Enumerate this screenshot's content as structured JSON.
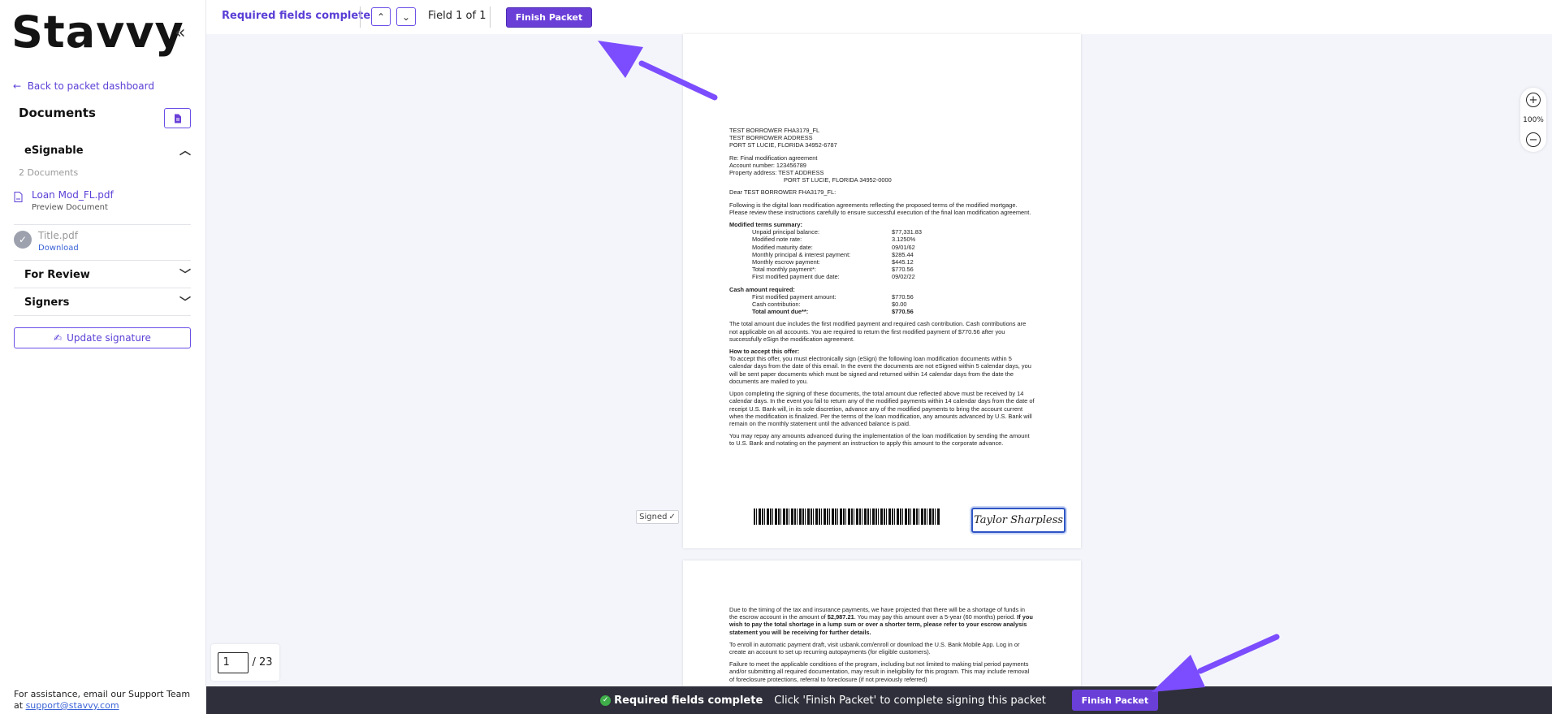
{
  "sidebar": {
    "logo": "Stavvy",
    "collapse_icon": "«",
    "back_link": "Back to packet dashboard",
    "documents_title": "Documents",
    "esignable": {
      "title": "eSignable",
      "count": "2 Documents",
      "docs": [
        {
          "name": "Loan Mod_FL.pdf",
          "sub": "Preview Document"
        },
        {
          "name": "Title.pdf",
          "sub": "Download"
        }
      ]
    },
    "for_review": "For Review",
    "signers": "Signers",
    "update_signature": "Update signature",
    "help_text": "For assistance, email our Support Team at",
    "help_email": "support@stavvy.com"
  },
  "toolbar": {
    "required_status": "Required fields complete",
    "field_count": "Field 1 of 1",
    "finish_label": "Finish Packet"
  },
  "document": {
    "address_lines": [
      "TEST BORROWER FHA3179_FL",
      "TEST BORROWER ADDRESS",
      "PORT ST LUCIE, FLORIDA 34952-6787"
    ],
    "re_lines": [
      "Re: Final modification agreement",
      "Account number: 123456789",
      "Property address: TEST ADDRESS"
    ],
    "re_city": "PORT ST LUCIE, FLORIDA 34952-0000",
    "greeting": "Dear TEST BORROWER FHA3179_FL:",
    "intro": "Following is the digital loan modification agreements reflecting the proposed terms of the modified mortgage. Please review these instructions carefully to ensure successful execution of the final loan modification agreement.",
    "terms_title": "Modified terms summary:",
    "terms": [
      {
        "k": "Unpaid principal balance:",
        "v": "$77,331.83"
      },
      {
        "k": "Modified note rate:",
        "v": "3.1250%"
      },
      {
        "k": "Modified maturity date:",
        "v": "09/01/62"
      },
      {
        "k": "Monthly principal & interest payment:",
        "v": "$285.44"
      },
      {
        "k": "Monthly escrow payment:",
        "v": "$445.12"
      },
      {
        "k": "Total monthly payment*:",
        "v": "$770.56"
      },
      {
        "k": "First modified payment due date:",
        "v": "09/02/22"
      }
    ],
    "cash_title": "Cash amount required:",
    "cash": [
      {
        "k": "First modified payment amount:",
        "v": "$770.56"
      },
      {
        "k": "Cash contribution:",
        "v": "$0.00"
      }
    ],
    "cash_total": {
      "k": "Total amount due**:",
      "v": "$770.56"
    },
    "para_total": "The total amount due includes the first modified payment and required cash contribution. Cash contributions are not applicable on all accounts. You are required to return the first modified payment of $770.56 after you successfully eSign the modification agreement.",
    "accept_title": "How to accept this offer:",
    "accept_text": "To accept this offer, you must electronically sign (eSign) the following loan modification documents within 5 calendar days from the date of this email. In the event the documents are not eSigned within 5 calendar days, you will be sent paper documents which must be signed and returned within 14 calendar days from the date the documents are mailed to you.",
    "para_upon": "Upon completing the signing of these documents, the total amount due reflected above must be received by 14 calendar days. In the event you fail to return any of the modified payments within 14 calendar days from the date of receipt U.S. Bank will, in its sole discretion, advance any of the modified payments to bring the account current when the modification is finalized. Per the terms of the loan modification, any amounts advanced by U.S. Bank will remain on the monthly statement until the advanced balance is paid.",
    "para_repay": "You may repay any amounts advanced during the implementation of the loan modification by sending the amount to U.S. Bank and notating on the payment an instruction to apply this amount to the corporate advance.",
    "signature": "Taylor Sharpless",
    "signed_tag": "Signed",
    "page2_p1a": "Due to the timing of the tax and insurance payments, we have projected that there will be a shortage of funds in the escrow account in the amount of",
    "page2_amount": "$2,987.21",
    "page2_p1b": ". You may pay this amount over a 5-year (60 months) period.",
    "page2_p1c": "If you wish to pay the total shortage in a lump sum or over a shorter term, please refer to your escrow analysis statement you will be receiving for further details.",
    "page2_p2": "To enroll in automatic payment draft, visit usbank.com/enroll or download the U.S. Bank Mobile App. Log in or create an account to set up recurring autopayments (for eligible customers).",
    "page2_p3": "Failure to meet the applicable conditions of the program, including but not limited to making trial period payments and/or submitting all required documentation, may result in ineligibility for this program. This may include removal of foreclosure protections, referral to foreclosure (if not previously referred)"
  },
  "zoom": {
    "level": "100%"
  },
  "pager": {
    "current": "1",
    "total": "/ 23"
  },
  "banner": {
    "status": "Required fields complete",
    "message": "Click 'Finish Packet' to complete signing this packet",
    "finish_label": "Finish Packet"
  },
  "colors": {
    "accent": "#6a3fd8",
    "arrow": "#7c4dff",
    "banner": "#2e2f3a",
    "success": "#3fae4a"
  }
}
